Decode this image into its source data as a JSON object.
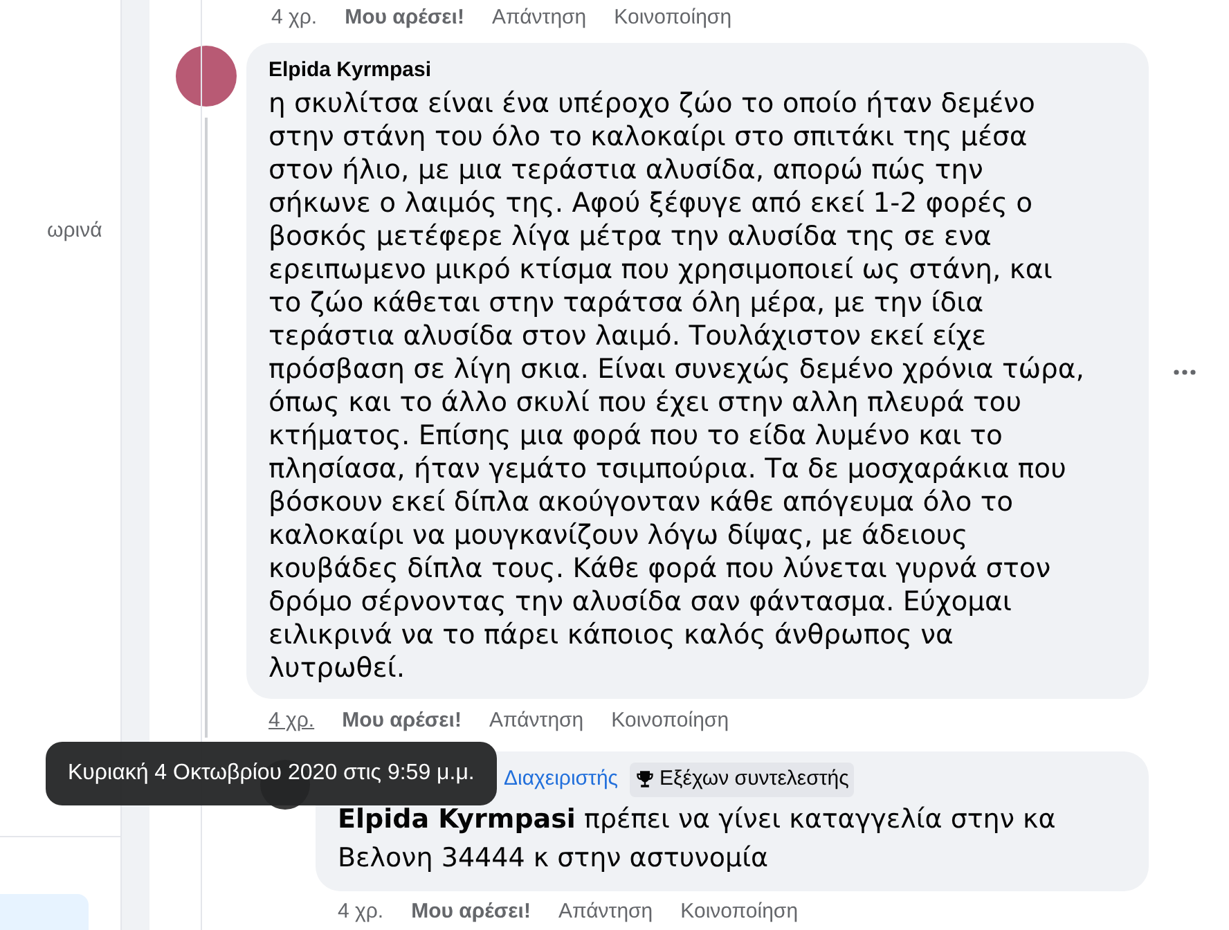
{
  "sidebar": {
    "text": "ωρινά"
  },
  "top_actions": {
    "time": "4 χρ.",
    "like": "Μου αρέσει!",
    "reply": "Απάντηση",
    "share": "Κοινοποίηση"
  },
  "comments": [
    {
      "author": "Elpida Kyrmpasi",
      "text": "η σκυλίτσα είναι ένα υπέροχο ζώο το οποίο ήταν δεμένο στην στάνη του όλο το καλοκαίρι στο σπιτάκι της μέσα στον ήλιο, με μια τεράστια αλυσίδα, απορώ πώς την σήκωνε ο λαιμός της. Αφού ξέφυγε από εκεί 1-2 φορές ο βοσκός μετέφερε λίγα μέτρα την αλυσίδα της σε ενα ερειπωμενο μικρό κτίσμα που χρησιμοποιεί ως στάνη, και το ζώο κάθεται στην ταράτσα όλη μέρα, με την ίδια τεράστια αλυσίδα στον λαιμό. Τουλάχιστον εκεί είχε πρόσβαση σε λίγη σκια. Είναι συνεχώς δεμένο χρόνια τώρα, όπως και το άλλο σκυλί που έχει στην αλλη πλευρά του κτήματος. Επίσης μια φορά που το είδα λυμένο και το πλησίασα, ήταν γεμάτο τσιμπούρια. Τα δε μοσχαράκια που βόσκουν εκεί δίπλα ακούγονταν κάθε απόγευμα όλο το καλοκαίρι να μουγκανίζουν λόγω δίψας, με άδειους κουβάδες δίπλα τους. Κάθε φορά που λύνεται γυρνά στον δρόμο σέρνοντας την αλυσίδα σαν φάντασμα. Εύχομαι ειλικρινά να το πάρει κάποιος καλός άνθρωπος να λυτρωθεί.",
      "time": "4 χρ.",
      "time_hovered": true,
      "like": "Μου αρέσει!",
      "reply": "Απάντηση",
      "share": "Κοινοποίηση"
    },
    {
      "role": "Διαχειριστής",
      "badge": "Εξέχων συντελεστής",
      "mention": "Elpida Kyrmpasi",
      "text": "πρέπει να γίνει καταγγελία στην κα Βελονη 34444 κ στην αστυνομία",
      "time": "4 χρ.",
      "time_hovered": false,
      "like": "Μου αρέσει!",
      "reply": "Απάντηση",
      "share": "Κοινοποίηση"
    }
  ],
  "tooltip": "Κυριακή 4 Οκτωβρίου 2020 στις 9:59 μ.μ."
}
